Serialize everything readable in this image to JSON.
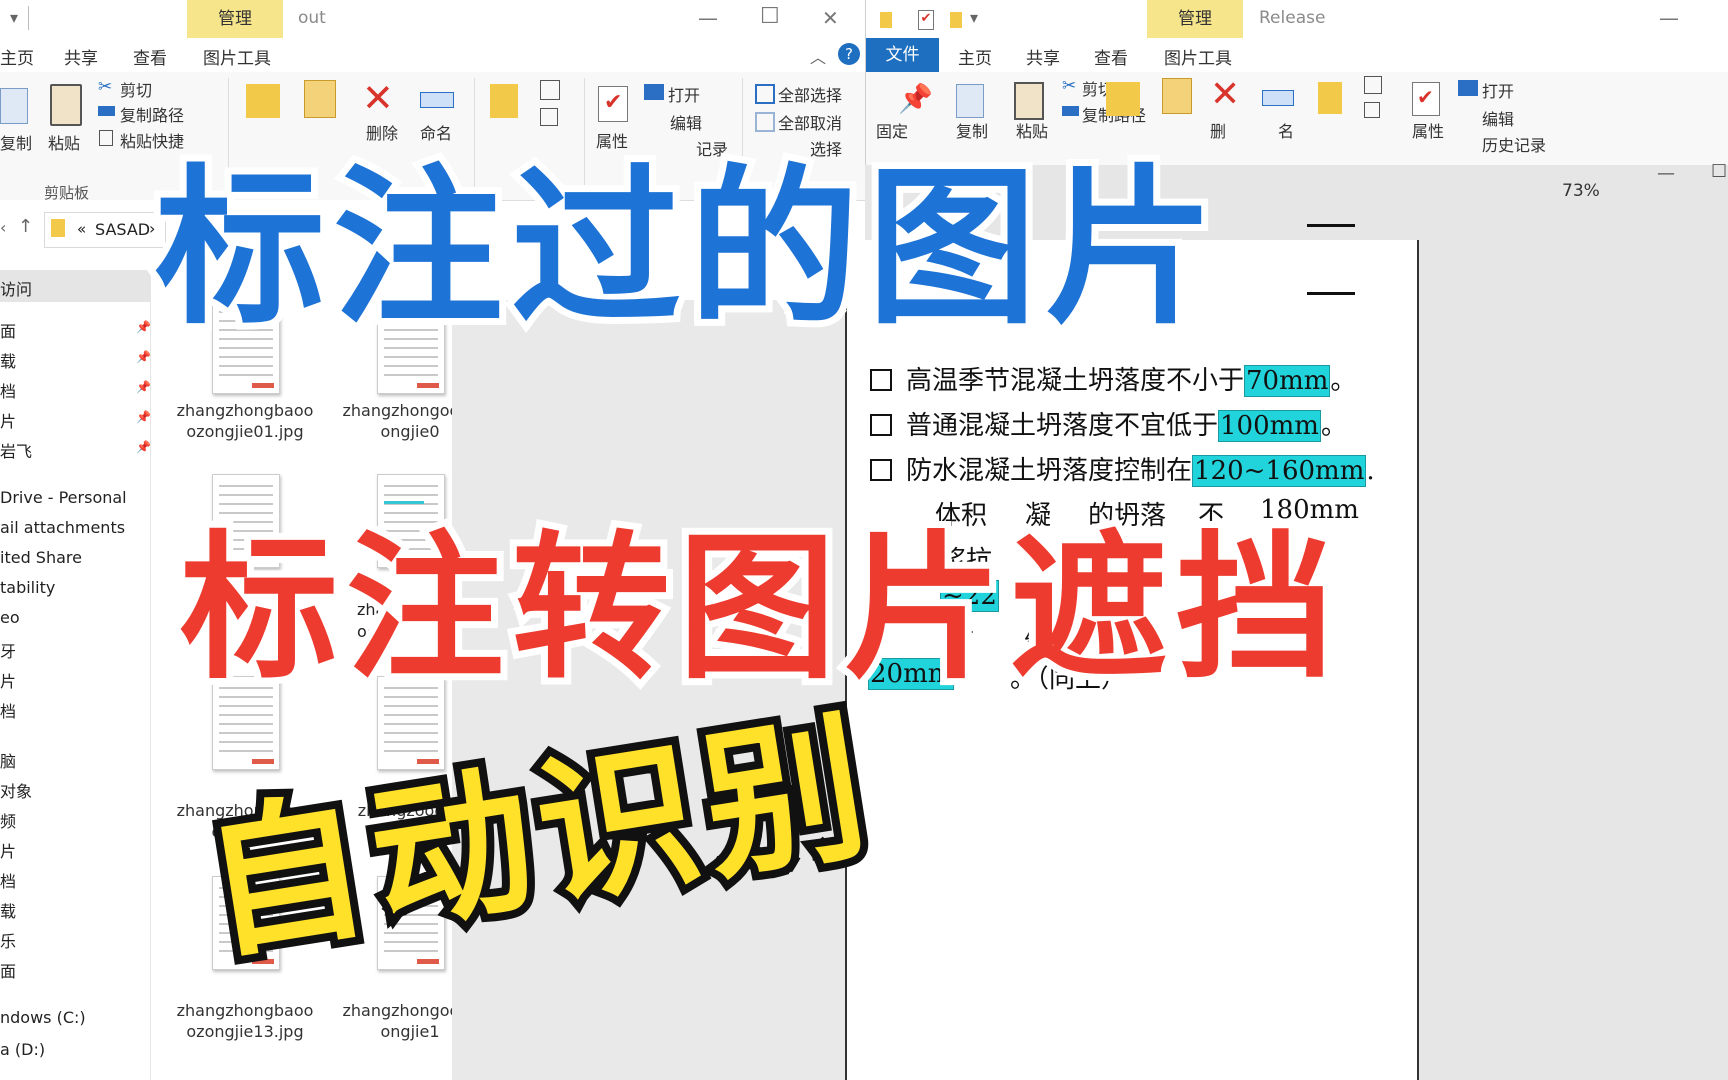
{
  "left_window": {
    "title": "out",
    "manage_tab": "管理",
    "menu": [
      "主页",
      "共享",
      "查看",
      "图片工具"
    ],
    "ribbon": {
      "cut": "剪切",
      "copy_path": "复制路径",
      "paste_shortcut": "粘贴快捷",
      "copy": "复制",
      "paste": "粘贴",
      "clipboard_group": "剪贴板",
      "delete": "删除",
      "rename": "命名",
      "open": "打开",
      "edit": "编辑",
      "properties": "属性",
      "select_all": "全部选择",
      "deselect_all": "全部取消",
      "history": "记录",
      "invert": "选择"
    },
    "address": {
      "path_sep": "«",
      "path": "SASAD",
      "chevron": "›"
    },
    "nav_header": "访问",
    "nav_items": [
      "面",
      "载",
      "档",
      "片",
      "岩飞",
      "Drive - Personal",
      "ail attachments",
      "ited Share",
      "tability",
      "eo",
      "牙",
      "片",
      "档",
      "脑",
      "对象",
      "频",
      "片",
      "档",
      "载",
      "乐",
      "面",
      "ndows (C:)",
      "a (D:)"
    ],
    "files": [
      "zhangzhongbaooozongjie01.jpg",
      "zhangzhongooozongjie0",
      "zhangzhongbaooozongjie",
      "zhangzooozo",
      "zhangzhongbaooozongjie13.jpg",
      "zhangzhongooozongjie1"
    ],
    "file_partial": [
      "zhar",
      "oc"
    ]
  },
  "right_window": {
    "title": "Release",
    "manage_tab": "管理",
    "menu": [
      "文件",
      "主页",
      "共享",
      "查看",
      "图片工具"
    ],
    "ribbon": {
      "pin": "固定",
      "copy": "复制",
      "paste": "粘贴",
      "cut": "剪切",
      "copy_path": "复制路径",
      "delete": "删",
      "rename": "名",
      "open": "打开",
      "edit": "编辑",
      "properties": "属性",
      "history": "历史记录"
    },
    "zoom": "73%",
    "doc_lines": [
      {
        "text": "高温季节混凝土坍落度不小于",
        "hl": "70mm",
        "end": "。"
      },
      {
        "text": "普通混凝土坍落度不宜低于",
        "hl": "100mm",
        "end": "。"
      },
      {
        "text": "防水混凝土坍落度控制在",
        "hl": "120~160mm",
        "end": "."
      }
    ],
    "doc_fragments": [
      "体积",
      "凝",
      "的坍落",
      "不",
      "180mm",
      "浆抗",
      "~22",
      "下",
      "续",
      "坍",
      "20mm",
      "。（同上）"
    ]
  },
  "overlay": {
    "line1": "标注过的图片",
    "line2": "标注转图片遮挡",
    "line3": "自动识别"
  },
  "colors": {
    "blue_title": "#1e73d6",
    "red_title": "#ee3b2f",
    "yellow_title": "#ffe12a",
    "highlight": "#21d3da",
    "file_tab": "#1e6fc0",
    "manage_tab": "#f6e58a"
  }
}
